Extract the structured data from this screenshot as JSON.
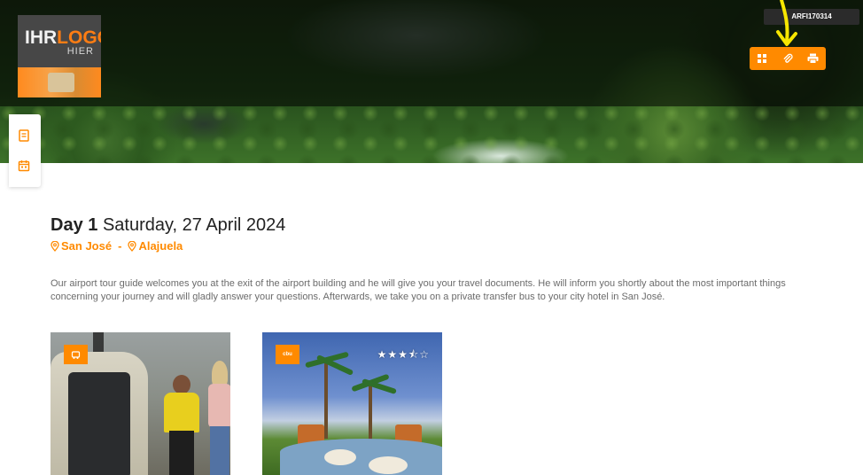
{
  "header": {
    "logo_main_left": "IHR",
    "logo_main_right": "LOGO",
    "logo_sub": "HIER",
    "reference_code": "ARFI170314"
  },
  "toolbar": {
    "icons": [
      "grid-icon",
      "paperclip-icon",
      "printer-icon"
    ],
    "accent_color": "#ff8a00"
  },
  "side_nav": {
    "icons": [
      "document-icon",
      "calendar-icon"
    ]
  },
  "day": {
    "label": "Day 1",
    "date": "Saturday, 27 April 2024",
    "route_from": "San José",
    "route_separator": "-",
    "route_to": "Alajuela",
    "description": "Our airport tour guide welcomes you at the exit of the airport building and he will give you your travel documents. He will inform you shortly about the most important things concerning your journey and will gladly answer your questions. Afterwards, we take you on a private transfer bus to your city hotel in San José."
  },
  "photos": [
    {
      "badge_icon": "transfer-icon"
    },
    {
      "badge_text": "cbu",
      "stars": "★★★⯪☆",
      "star_rating": 3.5
    }
  ],
  "colors": {
    "accent": "#ff8a00",
    "annotation": "#f7e600",
    "text_dark": "#222222",
    "text_muted": "#6b6b6b"
  }
}
